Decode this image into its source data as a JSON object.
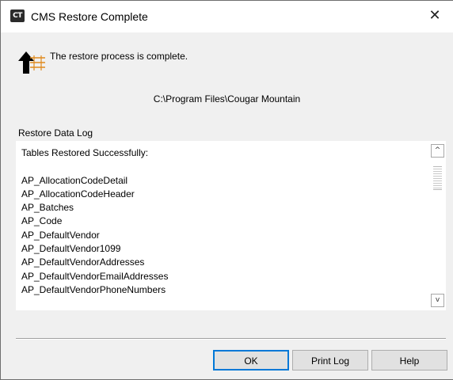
{
  "window": {
    "app_icon_text": "CT",
    "title": "CMS Restore Complete",
    "close_symbol": "✕"
  },
  "status": {
    "icon": "restore-arrow-icon",
    "message": "The restore process is complete."
  },
  "path": "C:\\Program Files\\Cougar Mountain",
  "log": {
    "label": "Restore Data Log",
    "lines": [
      "Tables Restored Successfully:",
      "",
      "AP_AllocationCodeDetail",
      "AP_AllocationCodeHeader",
      "AP_Batches",
      "AP_Code",
      "AP_DefaultVendor",
      "AP_DefaultVendor1099",
      "AP_DefaultVendorAddresses",
      "AP_DefaultVendorEmailAddresses",
      "AP_DefaultVendorPhoneNumbers"
    ]
  },
  "buttons": {
    "ok": "OK",
    "print_log": "Print Log",
    "help": "Help"
  },
  "colors": {
    "default_button_border": "#0078d7",
    "icon_arrow": "#000000",
    "icon_lines": "#e08a1e"
  }
}
